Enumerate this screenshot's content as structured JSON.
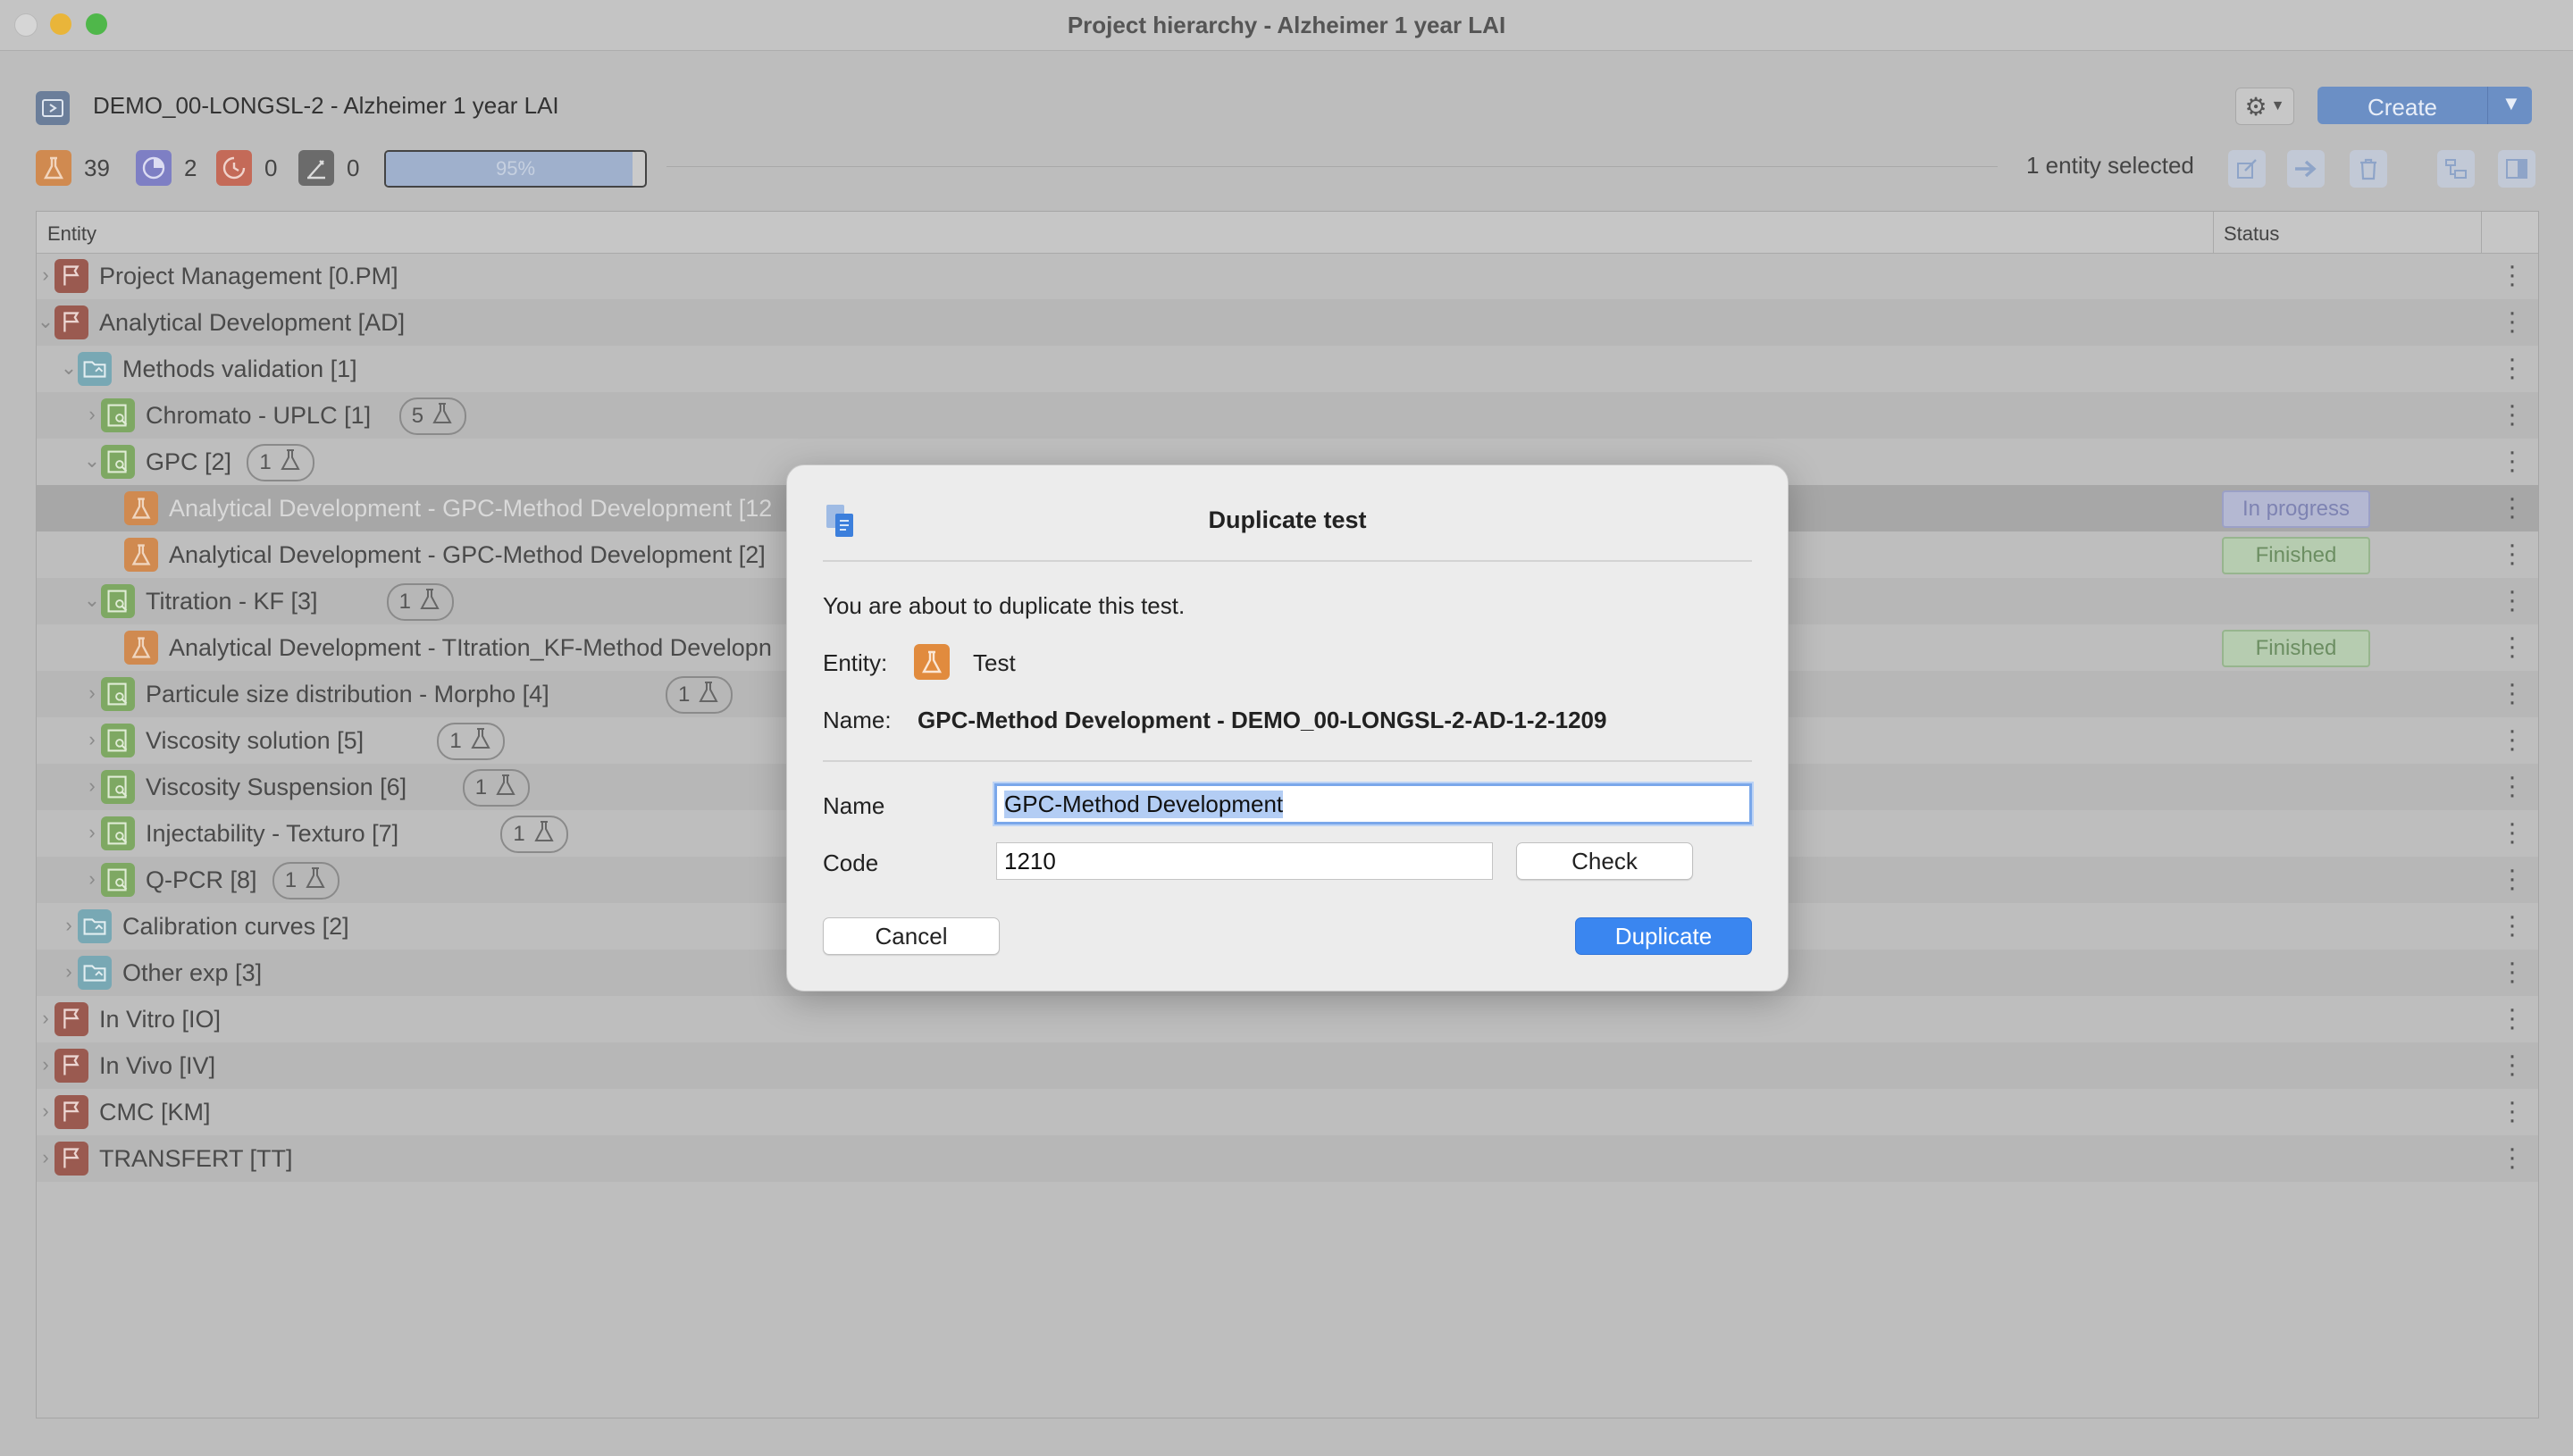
{
  "window": {
    "title": "Project hierarchy - Alzheimer 1 year LAI"
  },
  "header": {
    "project_title": "DEMO_00-LONGSL-2 - Alzheimer 1 year LAI",
    "create_label": "Create"
  },
  "stats": {
    "tests": "39",
    "in_progress": "2",
    "late": "0",
    "signed": "0",
    "progress_label": "95%",
    "progress_value": 0.95,
    "selected_label": "1 entity selected"
  },
  "table": {
    "col_entity": "Entity",
    "col_status": "Status",
    "rows": [
      {
        "label": "Project Management [0.PM]",
        "level": 0,
        "type": "flag",
        "expanded": false
      },
      {
        "label": "Analytical Development [AD]",
        "level": 0,
        "type": "flag",
        "expanded": true
      },
      {
        "label": "Methods validation [1]",
        "level": 1,
        "type": "folder",
        "expanded": true
      },
      {
        "label": "Chromato - UPLC [1]",
        "level": 2,
        "type": "sub",
        "expanded": false,
        "badge": "5"
      },
      {
        "label": "GPC [2]",
        "level": 2,
        "type": "sub",
        "expanded": true,
        "badge": "1"
      },
      {
        "label": "Analytical Development - GPC-Method Development [12",
        "level": 3,
        "type": "test",
        "status": "In progress",
        "selected": true
      },
      {
        "label": "Analytical Development - GPC-Method Development [2]",
        "level": 3,
        "type": "test",
        "status": "Finished"
      },
      {
        "label": "Titration - KF [3]",
        "level": 2,
        "type": "sub",
        "expanded": true,
        "badge": "1"
      },
      {
        "label": "Analytical Development - TItration_KF-Method Developn",
        "level": 3,
        "type": "test",
        "status": "Finished"
      },
      {
        "label": "Particule size distribution - Morpho [4]",
        "level": 2,
        "type": "sub",
        "expanded": false,
        "badge": "1"
      },
      {
        "label": "Viscosity solution [5]",
        "level": 2,
        "type": "sub",
        "expanded": false,
        "badge": "1"
      },
      {
        "label": "Viscosity Suspension [6]",
        "level": 2,
        "type": "sub",
        "expanded": false,
        "badge": "1"
      },
      {
        "label": "Injectability - Texturo [7]",
        "level": 2,
        "type": "sub",
        "expanded": false,
        "badge": "1"
      },
      {
        "label": "Q-PCR [8]",
        "level": 2,
        "type": "sub",
        "expanded": false,
        "badge": "1"
      },
      {
        "label": "Calibration curves [2]",
        "level": 1,
        "type": "folder",
        "expanded": false
      },
      {
        "label": "Other exp [3]",
        "level": 1,
        "type": "folder",
        "expanded": false
      },
      {
        "label": "In Vitro [IO]",
        "level": 0,
        "type": "flag",
        "expanded": false
      },
      {
        "label": "In Vivo [IV]",
        "level": 0,
        "type": "flag",
        "expanded": false
      },
      {
        "label": "CMC [KM]",
        "level": 0,
        "type": "flag",
        "expanded": false
      },
      {
        "label": "TRANSFERT [TT]",
        "level": 0,
        "type": "flag",
        "expanded": false
      }
    ]
  },
  "dialog": {
    "title": "Duplicate test",
    "description": "You are about to duplicate this test.",
    "entity_label": "Entity:",
    "entity_value": "Test",
    "name_label": "Name:",
    "name_value": "GPC-Method Development - DEMO_00-LONGSL-2-AD-1-2-1209",
    "field_name_label": "Name",
    "field_name_value": "GPC-Method Development",
    "field_code_label": "Code",
    "field_code_value": "1210",
    "check_label": "Check",
    "cancel_label": "Cancel",
    "duplicate_label": "Duplicate"
  },
  "colors": {
    "flag": "#9a5a50",
    "folder": "#78a8b4",
    "sub": "#7ea863",
    "test": "#d08a50",
    "primary": "#3a86f0",
    "in_progress": "#7e83b2",
    "finished": "#6c8e62"
  }
}
